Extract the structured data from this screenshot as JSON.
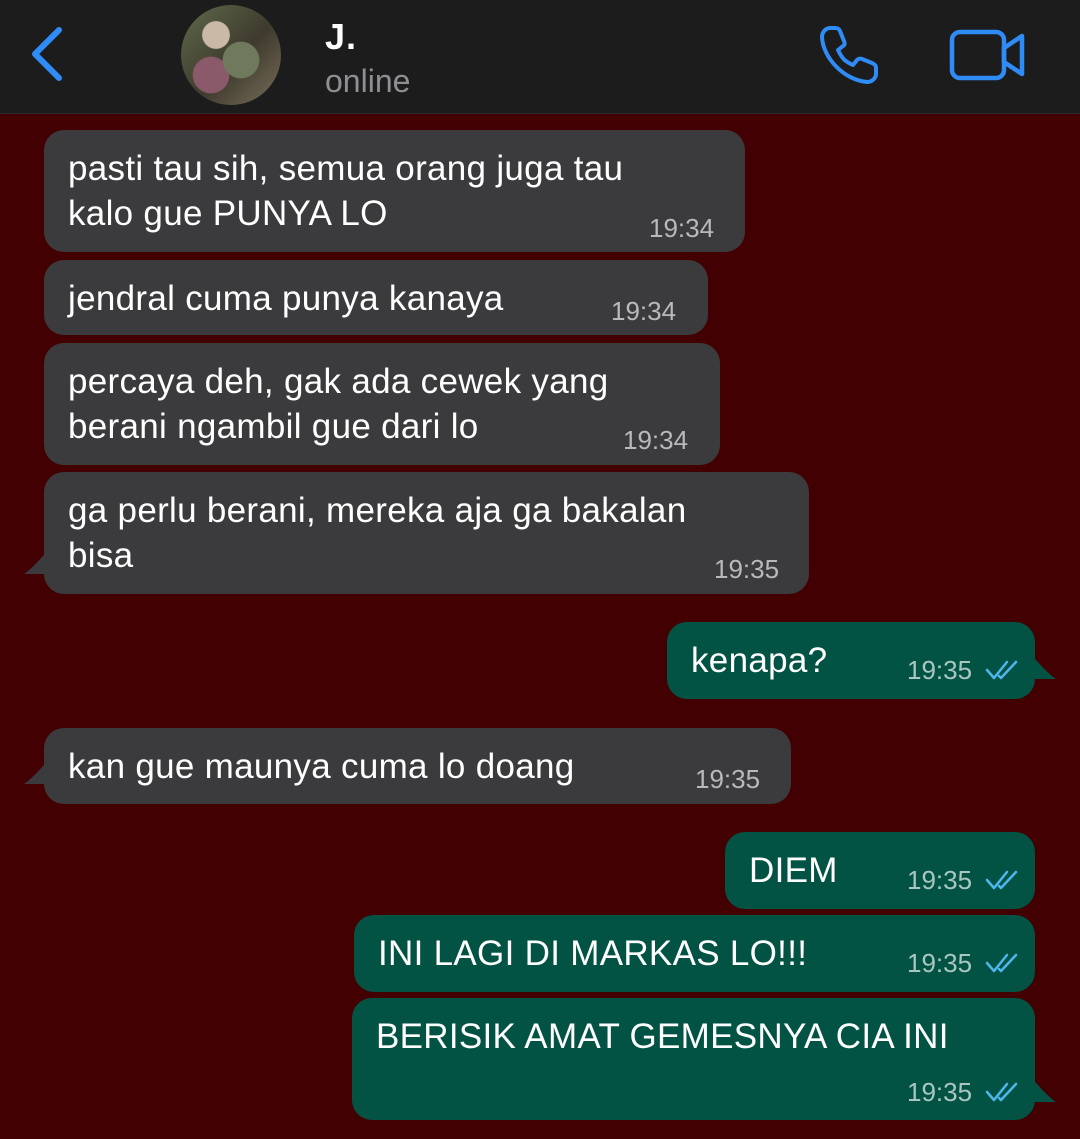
{
  "header": {
    "contact_name": "J.",
    "contact_status": "online"
  },
  "colors": {
    "background": "#420003",
    "header": "#1c1c1d",
    "incoming_bubble": "#3b3b3d",
    "outgoing_bubble": "#035345",
    "accent": "#2f8cf6",
    "read_ticks": "#4fb6ec"
  },
  "icons": {
    "back": "chevron-left-icon",
    "call": "phone-icon",
    "video": "video-camera-icon",
    "read": "double-check-icon"
  },
  "messages": [
    {
      "direction": "incoming",
      "text": "pasti tau sih, semua orang juga tau\nkalo gue PUNYA LO",
      "time": "19:34"
    },
    {
      "direction": "incoming",
      "text": "jendral cuma punya kanaya",
      "time": "19:34"
    },
    {
      "direction": "incoming",
      "text": "percaya deh, gak ada cewek yang\nberani ngambil gue dari lo",
      "time": "19:34"
    },
    {
      "direction": "incoming",
      "text": "ga perlu berani, mereka aja ga bakalan\nbisa",
      "time": "19:35"
    },
    {
      "direction": "outgoing",
      "text": "kenapa?",
      "time": "19:35",
      "status": "read"
    },
    {
      "direction": "incoming",
      "text": "kan gue maunya cuma lo doang",
      "time": "19:35"
    },
    {
      "direction": "outgoing",
      "text": "DIEM",
      "time": "19:35",
      "status": "read"
    },
    {
      "direction": "outgoing",
      "text": "INI LAGI DI MARKAS LO!!!",
      "time": "19:35",
      "status": "read"
    },
    {
      "direction": "outgoing",
      "text": "BERISIK AMAT GEMESNYA CIA INI",
      "time": "19:35",
      "status": "read"
    }
  ]
}
